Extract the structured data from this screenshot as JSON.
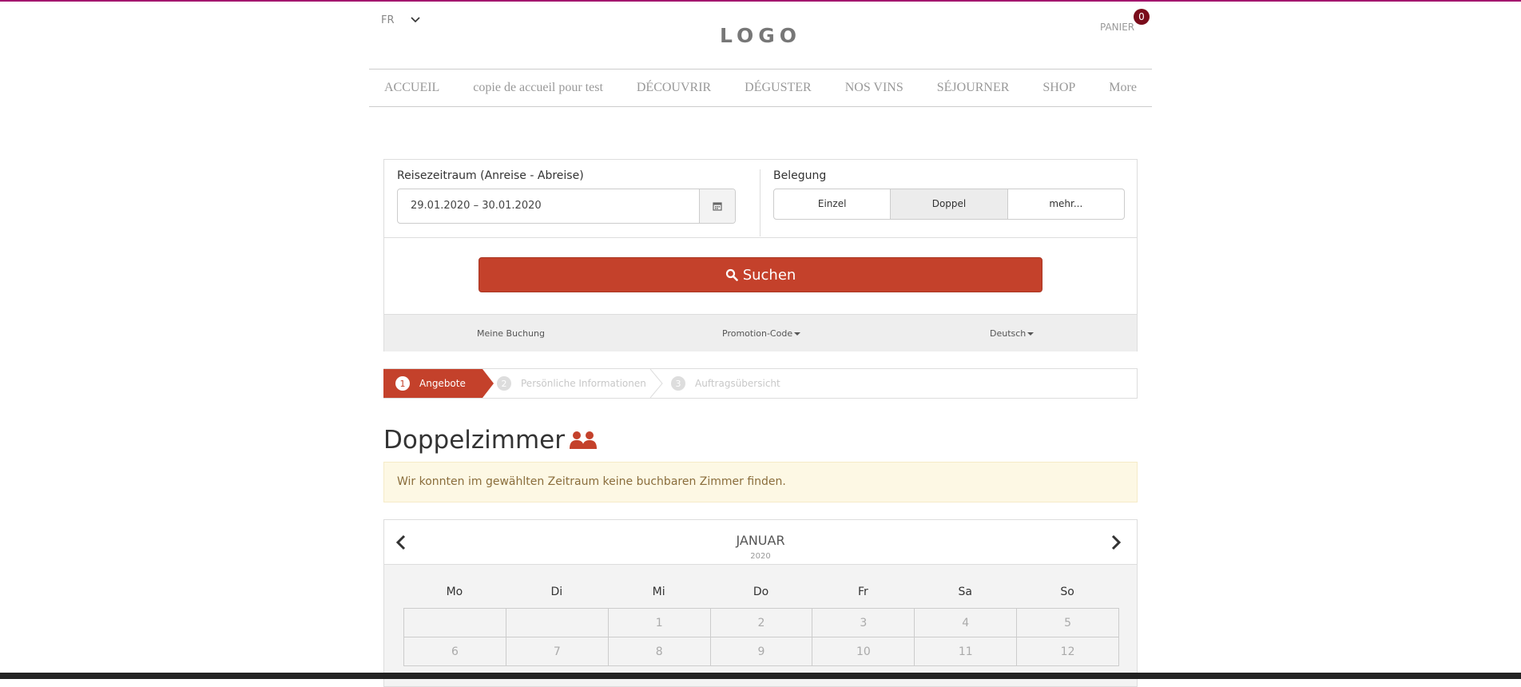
{
  "header": {
    "language": "FR",
    "logo": "LOGO",
    "cart_label": "PANIER",
    "cart_count": "0"
  },
  "nav": {
    "items": [
      "ACCUEIL",
      "copie de accueil pour test",
      "DÉCOUVRIR",
      "DÉGUSTER",
      "NOS VINS",
      "SÉJOURNER",
      "SHOP",
      "More"
    ]
  },
  "booking": {
    "period_label": "Reisezeitraum (Anreise - Abreise)",
    "period_value": "29.01.2020 – 30.01.2020",
    "occupancy_label": "Belegung",
    "occupancy_options": [
      "Einzel",
      "Doppel",
      "mehr..."
    ],
    "occupancy_selected": "Doppel",
    "search_label": "Suchen",
    "footer_links": {
      "my_booking": "Meine Buchung",
      "promo": "Promotion-Code",
      "language": "Deutsch"
    }
  },
  "steps": [
    {
      "num": "1",
      "label": "Angebote"
    },
    {
      "num": "2",
      "label": "Persönliche Informationen"
    },
    {
      "num": "3",
      "label": "Auftragsübersicht"
    }
  ],
  "room": {
    "title": "Doppelzimmer",
    "alert": "Wir konnten im gewählten Zeitraum keine buchbaren Zimmer finden."
  },
  "calendar": {
    "month": "JANUAR",
    "year": "2020",
    "weekdays": [
      "Mo",
      "Di",
      "Mi",
      "Do",
      "Fr",
      "Sa",
      "So"
    ],
    "rows": [
      [
        "",
        "",
        "1",
        "2",
        "3",
        "4",
        "5"
      ],
      [
        "6",
        "7",
        "8",
        "9",
        "10",
        "11",
        "12"
      ]
    ]
  },
  "colors": {
    "accent": "#c4412b",
    "top_border": "#a3166e",
    "cart_badge": "#7a0c1b",
    "alert_bg": "#fdf8e4"
  }
}
